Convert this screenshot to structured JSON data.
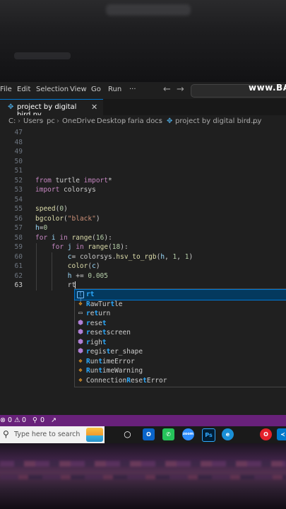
{
  "menubar": {
    "items": [
      "File",
      "Edit",
      "Selection",
      "View",
      "Go",
      "Run",
      "···"
    ],
    "back": "←",
    "forward": "→",
    "watermark": "www.BA"
  },
  "tab": {
    "title": "project by digital bird.py",
    "close": "✕"
  },
  "breadcrumb": [
    "C:",
    "Users",
    "pc",
    "OneDrive",
    "Desktop",
    "faria docs",
    "project by digital bird.py",
    "..."
  ],
  "editor": {
    "line_numbers": [
      "47",
      "48",
      "49",
      "50",
      "51",
      "52",
      "53",
      "54",
      "55",
      "56",
      "57",
      "58",
      "59",
      "60",
      "61",
      "62",
      "63"
    ],
    "current_line": "63"
  },
  "suggestions": [
    {
      "label": "rt",
      "kind": "variable",
      "icon": "variable-icon",
      "match": "rt"
    },
    {
      "label": "RawTurtle",
      "kind": "class",
      "icon": "class-icon",
      "match": "R"
    },
    {
      "label": "return",
      "kind": "keyword",
      "icon": "keyword-icon",
      "match": "re"
    },
    {
      "label": "reset",
      "kind": "function",
      "icon": "function-icon",
      "match": "re"
    },
    {
      "label": "resetscreen",
      "kind": "function",
      "icon": "function-icon",
      "match": "re"
    },
    {
      "label": "right",
      "kind": "function",
      "icon": "function-icon",
      "match": "r"
    },
    {
      "label": "register_shape",
      "kind": "function",
      "icon": "function-icon",
      "match": "r"
    },
    {
      "label": "RuntimeError",
      "kind": "class",
      "icon": "class-icon",
      "match": "R"
    },
    {
      "label": "RuntimeWarning",
      "kind": "class",
      "icon": "class-icon",
      "match": "R"
    },
    {
      "label": "ConnectionResetError",
      "kind": "class",
      "icon": "class-icon",
      "match": "R"
    }
  ],
  "statusbar": {
    "errors": "0",
    "warnings": "0",
    "ports": "0"
  },
  "taskbar": {
    "search_placeholder": "Type here to search",
    "icons": [
      "task-view-icon",
      "outlook-icon",
      "whatsapp-icon",
      "zoom-icon",
      "photoshop-icon",
      "edge-icon",
      "opera-icon",
      "vscode-icon"
    ]
  },
  "colors": {
    "statusbar": "#68217a",
    "accent": "#0078d4",
    "editor_bg": "#1f1f1f"
  }
}
